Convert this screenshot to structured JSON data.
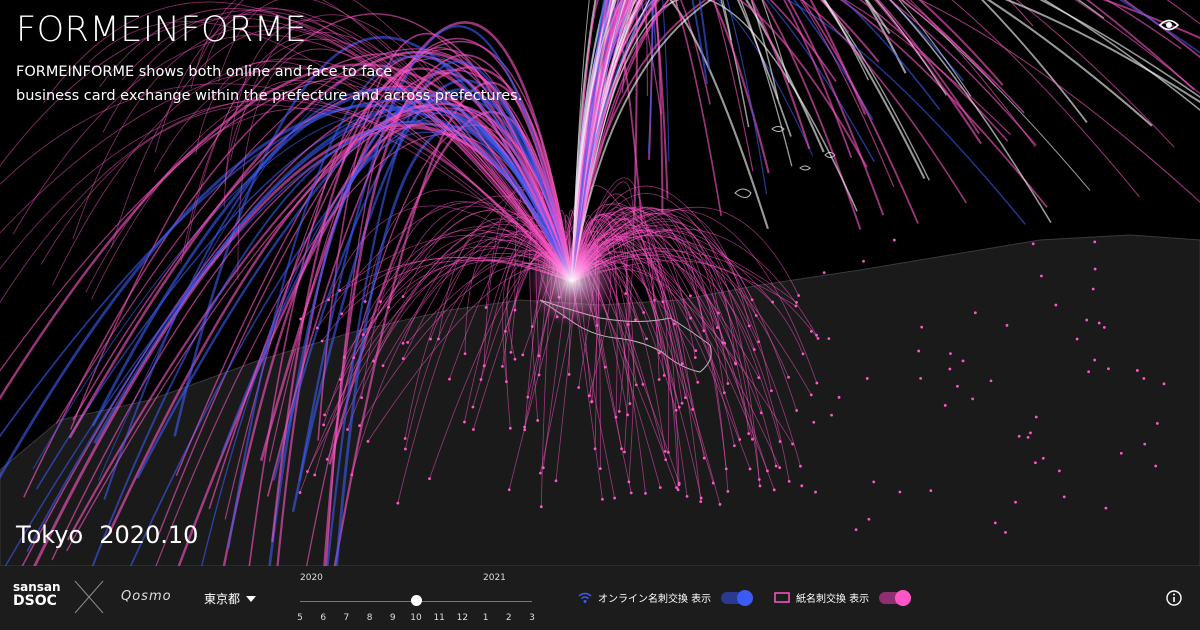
{
  "header": {
    "title": "FORMEINFORME",
    "description_line1": "FORMEINFORME shows both online and face to face",
    "description_line2": "business card exchange within the prefecture and across prefectures."
  },
  "readout": {
    "place": "Tokyo",
    "period": "2020.10"
  },
  "footer": {
    "logo_line1": "sansan",
    "logo_line2": "DSOC",
    "partner_logo": "Qosmo",
    "prefecture_select": {
      "value": "東京都"
    },
    "timeline": {
      "year_start": "2020",
      "year_next": "2021",
      "months": [
        "5",
        "6",
        "7",
        "8",
        "9",
        "10",
        "11",
        "12",
        "1",
        "2",
        "3"
      ],
      "selected_index": 5
    },
    "online_toggle": {
      "label": "オンライン名刺交換 表示",
      "on": true
    },
    "paper_toggle": {
      "label": "紙名刺交換 表示",
      "on": true
    }
  },
  "colors": {
    "online": "#3a5cf5",
    "paper": "#ff56c8",
    "bar_bg": "#1c1c1c"
  },
  "icons": {
    "eye": "eye-icon",
    "wifi": "wifi-icon",
    "card": "card-icon",
    "info": "info-icon",
    "caret": "chevron-down-icon"
  }
}
